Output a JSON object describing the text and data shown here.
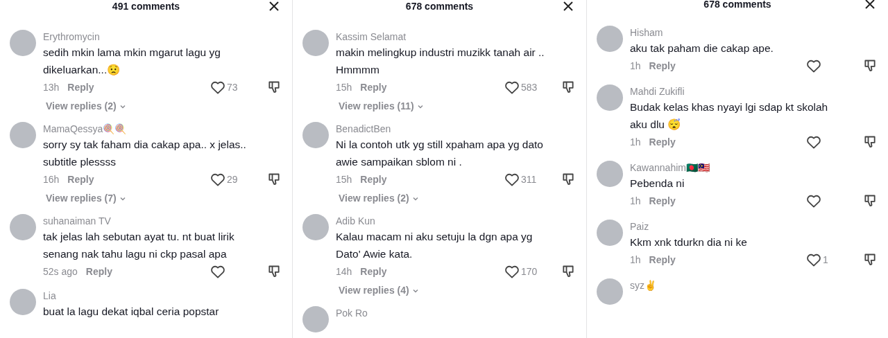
{
  "panels": [
    {
      "title": "491 comments",
      "comments": [
        {
          "name": "Erythromycin",
          "text": "sedih mkin lama mkin mgarut lagu yg dikeluarkan...😟",
          "time": "13h",
          "reply": "Reply",
          "likes": "73",
          "view_replies": "View replies (2)"
        },
        {
          "name": "MamaQessya🍭🍭",
          "text": "sorry sy tak faham dia cakap apa.. x jelas.. subtitle plessss",
          "time": "16h",
          "reply": "Reply",
          "likes": "29",
          "view_replies": "View replies (7)"
        },
        {
          "name": "suhanaiman TV",
          "text": "tak jelas lah sebutan ayat tu. nt buat lirik senang nak tahu lagu ni ckp pasal apa",
          "time": "52s ago",
          "reply": "Reply"
        },
        {
          "name": "Lia",
          "text": "buat la lagu dekat iqbal ceria popstar"
        }
      ]
    },
    {
      "title": "678 comments",
      "comments": [
        {
          "name": "Kassim Selamat",
          "text": "makin melingkup industri muzikk tanah air .. Hmmmm",
          "time": "15h",
          "reply": "Reply",
          "likes": "583",
          "view_replies": "View replies (11)"
        },
        {
          "name": "BenadictBen",
          "text": "Ni la contoh utk yg still xpaham apa yg dato awie sampaikan sblom ni .",
          "time": "15h",
          "reply": "Reply",
          "likes": "311",
          "view_replies": "View replies (2)"
        },
        {
          "name": "Adib Kun",
          "text": "Kalau macam ni aku setuju la dgn apa yg Dato' Awie kata.",
          "time": "14h",
          "reply": "Reply",
          "likes": "170",
          "view_replies": "View replies (4)"
        },
        {
          "name": "Pok Ro"
        }
      ]
    },
    {
      "title": "678 comments",
      "comments": [
        {
          "name": "Hisham",
          "text": "aku tak paham die cakap ape.",
          "time": "1h",
          "reply": "Reply"
        },
        {
          "name": "Mahdi Zukifli",
          "text": "Budak kelas khas nyayi lgi sdap kt skolah aku dlu 😴",
          "time": "1h",
          "reply": "Reply"
        },
        {
          "name": "Kawannahim🇧🇩🇲🇾",
          "text": "Pebenda ni",
          "time": "1h",
          "reply": "Reply"
        },
        {
          "name": "Paiz",
          "text": "Kkm xnk tdurkn dia ni ke",
          "time": "1h",
          "reply": "Reply",
          "likes": "1"
        },
        {
          "name": "syz✌"
        }
      ]
    }
  ]
}
